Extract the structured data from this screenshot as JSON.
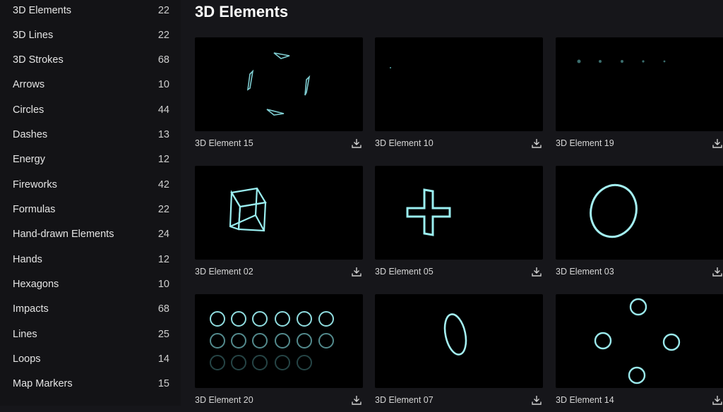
{
  "sidebar": {
    "items": [
      {
        "label": "3D Elements",
        "count": "22"
      },
      {
        "label": "3D Lines",
        "count": "22"
      },
      {
        "label": "3D Strokes",
        "count": "68"
      },
      {
        "label": "Arrows",
        "count": "10"
      },
      {
        "label": "Circles",
        "count": "44"
      },
      {
        "label": "Dashes",
        "count": "13"
      },
      {
        "label": "Energy",
        "count": "12"
      },
      {
        "label": "Fireworks",
        "count": "42"
      },
      {
        "label": "Formulas",
        "count": "22"
      },
      {
        "label": "Hand-drawn Elements",
        "count": "24"
      },
      {
        "label": "Hands",
        "count": "12"
      },
      {
        "label": "Hexagons",
        "count": "10"
      },
      {
        "label": "Impacts",
        "count": "68"
      },
      {
        "label": "Lines",
        "count": "25"
      },
      {
        "label": "Loops",
        "count": "14"
      },
      {
        "label": "Map Markers",
        "count": "15"
      }
    ]
  },
  "main": {
    "title": "3D Elements",
    "cards": [
      {
        "title": "3D Element 15",
        "preview": "four-shards"
      },
      {
        "title": "3D Element 10",
        "preview": "dot"
      },
      {
        "title": "3D Element 19",
        "preview": "dots-row"
      },
      {
        "title": "3D Element 02",
        "preview": "cube"
      },
      {
        "title": "3D Element 05",
        "preview": "cross"
      },
      {
        "title": "3D Element 03",
        "preview": "ring"
      },
      {
        "title": "3D Element 20",
        "preview": "circle-grid"
      },
      {
        "title": "3D Element 07",
        "preview": "ellipse"
      },
      {
        "title": "3D Element 14",
        "preview": "four-circles"
      }
    ]
  },
  "icons": {
    "download": "download-icon"
  },
  "colors": {
    "glow": "#7fe3e6",
    "background": "#16161a",
    "thumb": "#000000"
  }
}
